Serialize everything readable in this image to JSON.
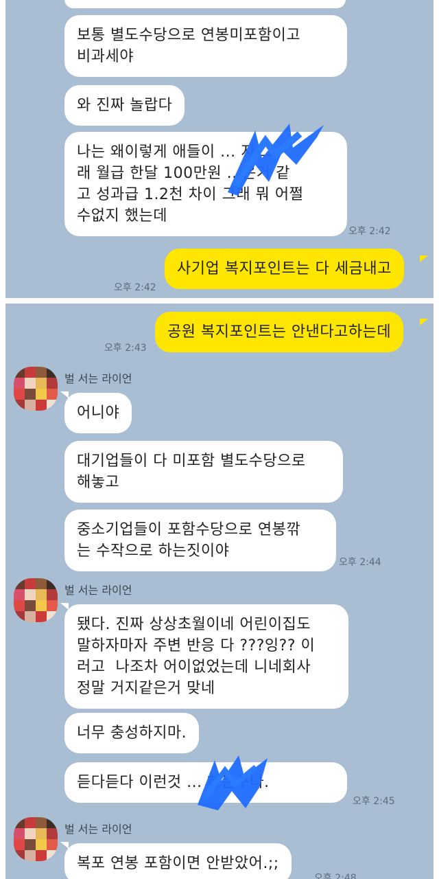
{
  "chat": {
    "panel1": {
      "m1": "보통 별도수당으로 연봉미포함이고\n비과세야",
      "m2": "와 진짜 놀랍다",
      "m3": "나는 왜이렇게 애들이 ... 지 그\n래 월급 한달 100만원 ...은거 같\n고 성과급 1.2천 차이 그래 뭐 어쩔\n수없지 했는데",
      "t1": "오후 2:42",
      "me1": "사기업 복지포인트는 다 세금내고",
      "t_me1": "오후 2:42"
    },
    "panel2": {
      "me2": "공원 복지포인트는 안낸다고하는데",
      "t_me2": "오후 2:43",
      "sender": "벌 서는 라이언",
      "g1_m1": "어니야",
      "g1_m2": "대기업들이 다 미포함 별도수당으로\n해놓고",
      "g1_m3": "중소기업들이 포함수당으로 연봉깎\n는 수작으로 하는짓이야",
      "g1_t": "오후 2:44",
      "g2_m1": "됐다. 진짜 상상초월이네 어린이집도\n말하자마자 주변 반응 다 ???잉?? 이\n러고  나조차 어이없었는데 니네회사\n정말 거지같은거 맞네",
      "g2_m2": "너무 충성하지마.",
      "g2_m3": "듣다듣다 이런것 ... 하는구나.",
      "g2_t": "오후 2:45",
      "g3_m1": "복포 연봉 포함이면 안받았어.;;",
      "g3_t": "오후 2:48"
    }
  },
  "colors": {
    "chat_bg": "#a9bdd3",
    "my_bubble": "#fee600",
    "other_bubble": "#ffffff",
    "redaction": "#1f6bff"
  },
  "icons": {
    "avatar": "pixelated-profile-picture"
  }
}
